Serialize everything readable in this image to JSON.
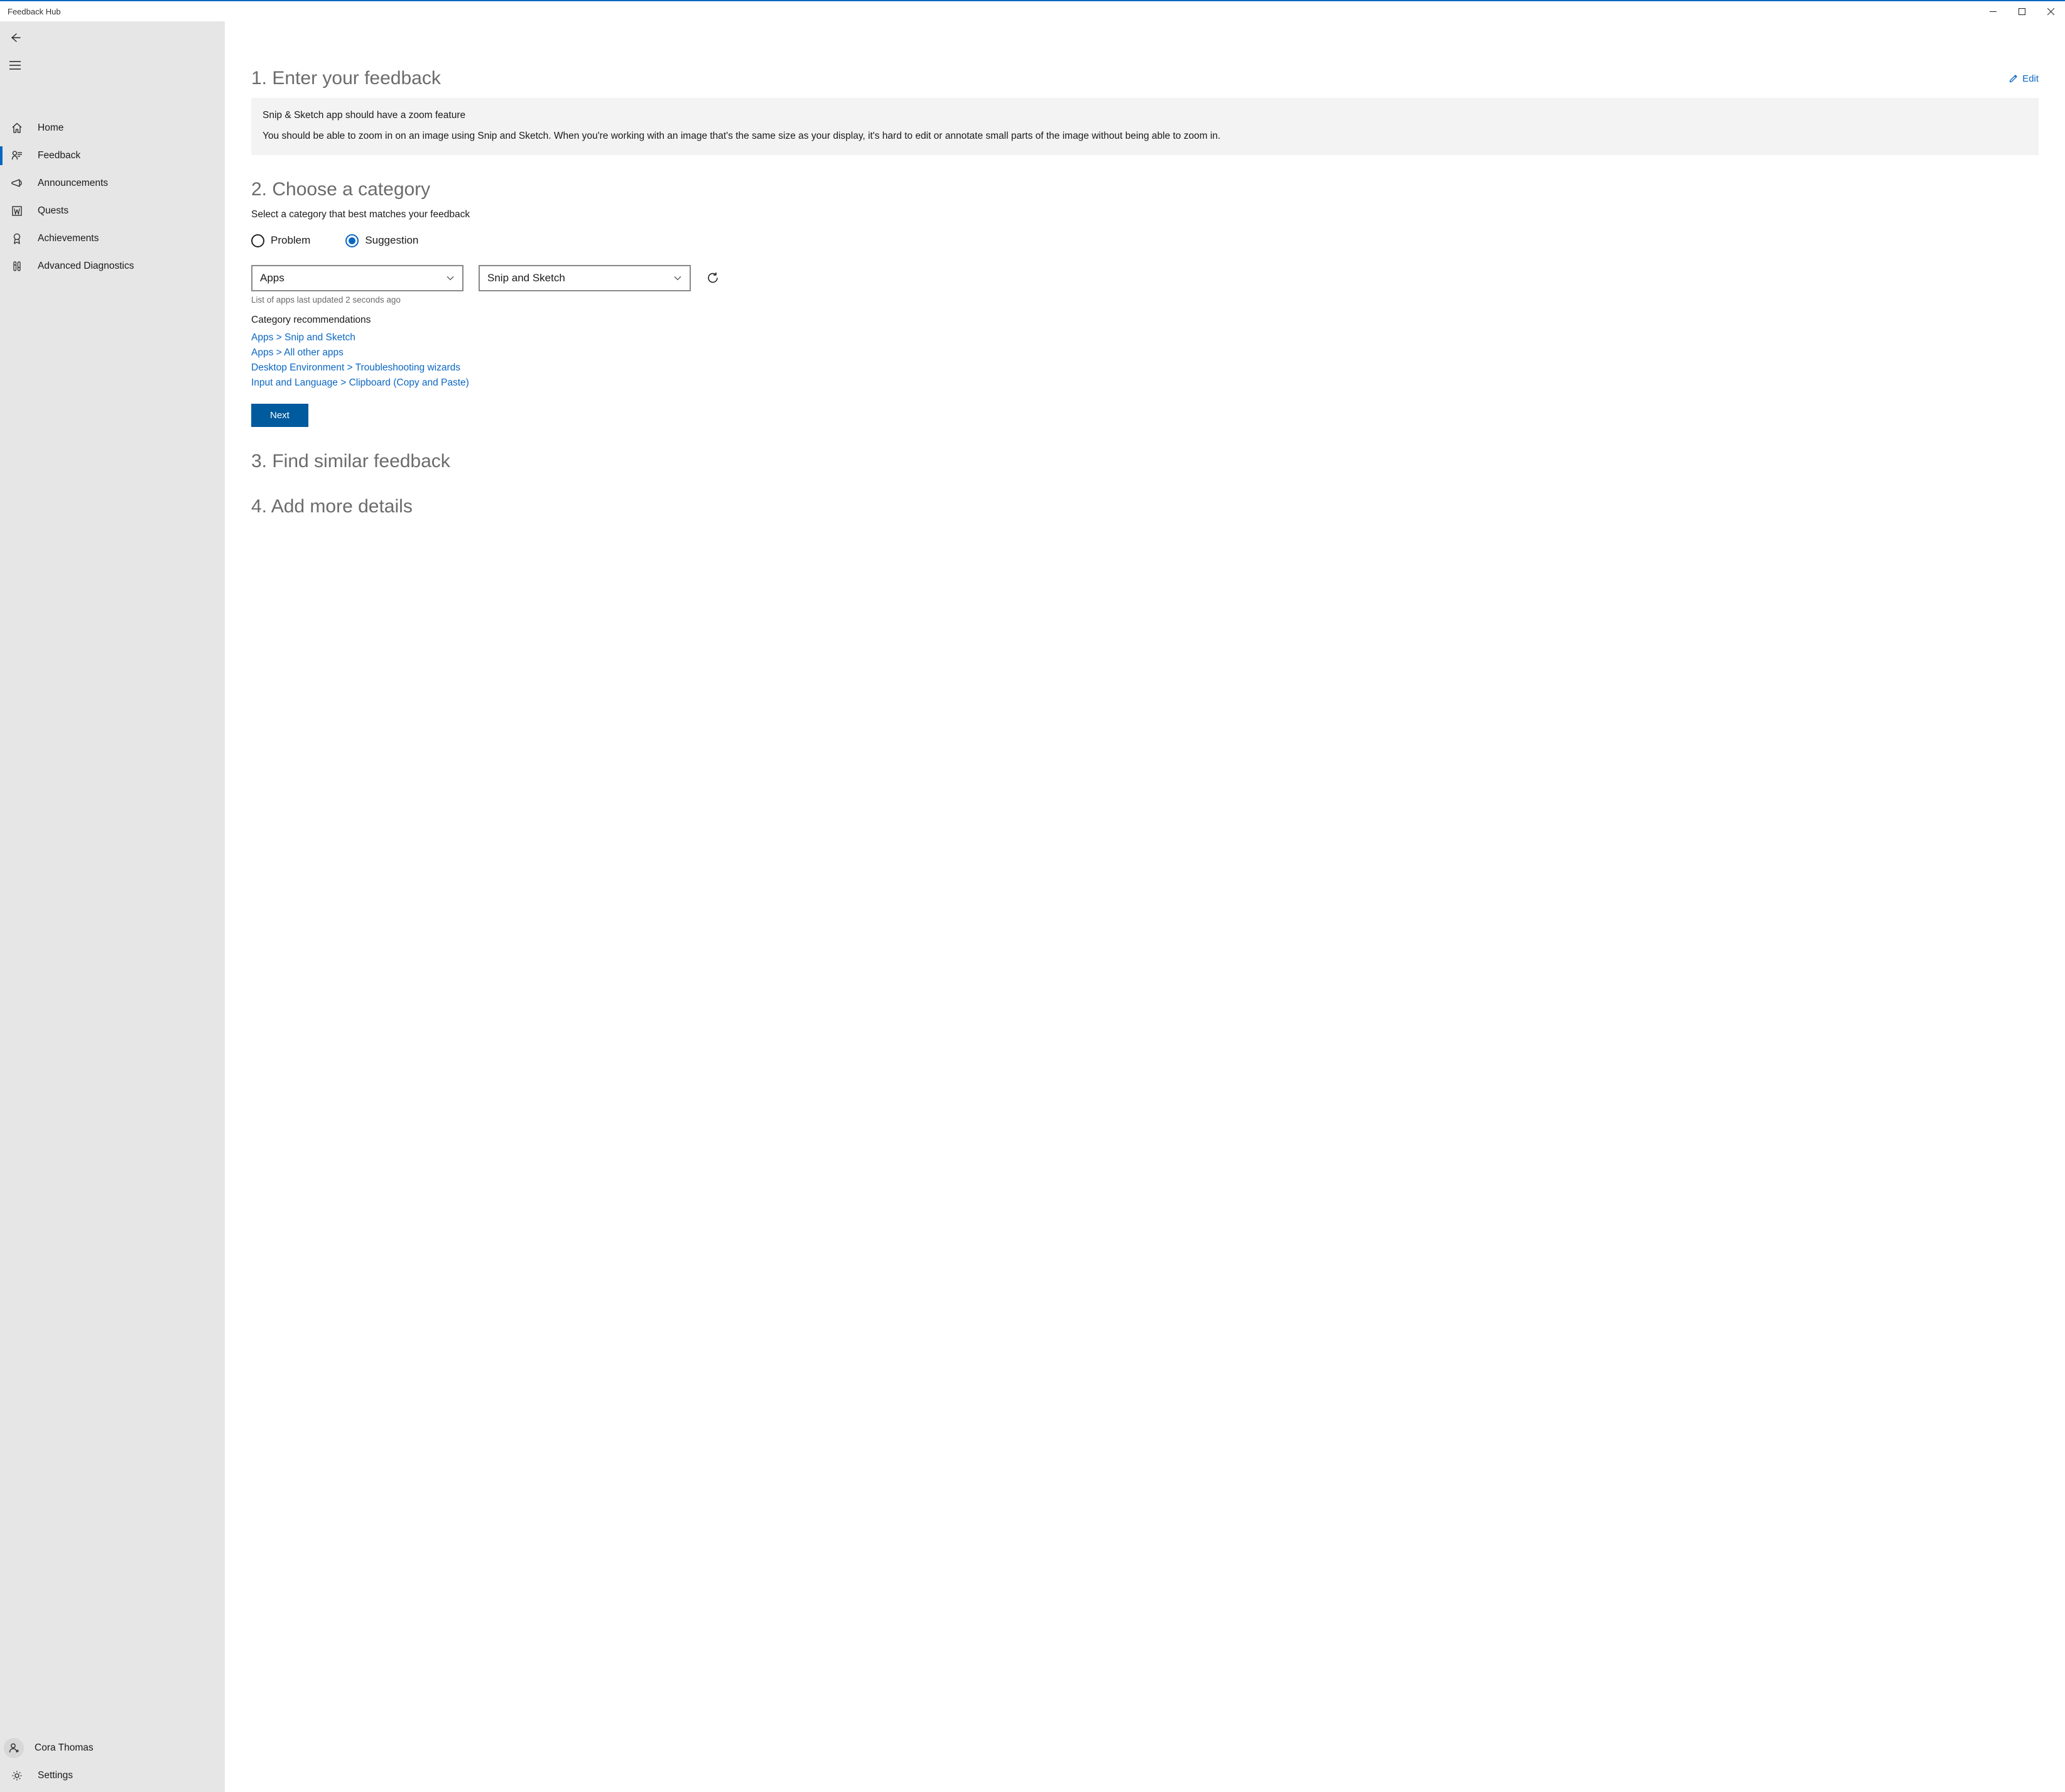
{
  "window": {
    "title": "Feedback Hub"
  },
  "sidebar": {
    "items": [
      {
        "label": "Home"
      },
      {
        "label": "Feedback"
      },
      {
        "label": "Announcements"
      },
      {
        "label": "Quests"
      },
      {
        "label": "Achievements"
      },
      {
        "label": "Advanced Diagnostics"
      }
    ],
    "user": "Cora Thomas",
    "settings": "Settings"
  },
  "step1": {
    "heading": "1. Enter your feedback",
    "edit": "Edit",
    "title": "Snip & Sketch app should have a zoom feature",
    "body": "You should be able to zoom in on an image using Snip and Sketch. When you're working with an image that's the same size as your display, it's hard to edit or annotate small parts of the image without being able to zoom in."
  },
  "step2": {
    "heading": "2. Choose a category",
    "sub": "Select a category that best matches your feedback",
    "opt_problem": "Problem",
    "opt_suggestion": "Suggestion",
    "select1": "Apps",
    "select2": "Snip and Sketch",
    "hint": "List of apps last updated 2 seconds ago",
    "recs_title": "Category recommendations",
    "recs": [
      "Apps > Snip and Sketch",
      "Apps > All other apps",
      "Desktop Environment > Troubleshooting wizards",
      "Input and Language > Clipboard (Copy and Paste)"
    ],
    "next": "Next"
  },
  "step3": {
    "heading": "3. Find similar feedback"
  },
  "step4": {
    "heading": "4. Add more details"
  }
}
